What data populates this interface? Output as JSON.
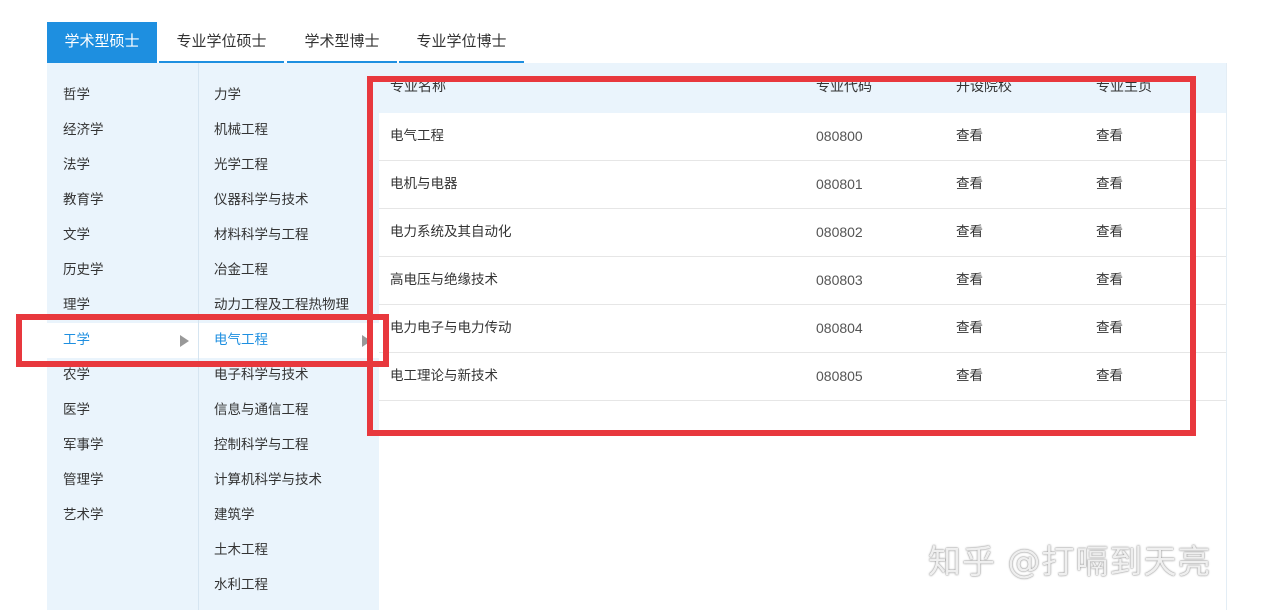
{
  "tabs": [
    {
      "label": "学术型硕士",
      "active": true
    },
    {
      "label": "专业学位硕士",
      "active": false
    },
    {
      "label": "学术型博士",
      "active": false
    },
    {
      "label": "专业学位博士",
      "active": false
    }
  ],
  "categories": [
    "哲学",
    "经济学",
    "法学",
    "教育学",
    "文学",
    "历史学",
    "理学",
    "工学",
    "农学",
    "医学",
    "军事学",
    "管理学",
    "艺术学"
  ],
  "selected_category": "工学",
  "disciplines": [
    "力学",
    "机械工程",
    "光学工程",
    "仪器科学与技术",
    "材料科学与工程",
    "冶金工程",
    "动力工程及工程热物理",
    "电气工程",
    "电子科学与技术",
    "信息与通信工程",
    "控制科学与工程",
    "计算机科学与技术",
    "建筑学",
    "土木工程",
    "水利工程"
  ],
  "selected_discipline": "电气工程",
  "table": {
    "headers": [
      "专业名称",
      "专业代码",
      "开设院校",
      "专业主页"
    ],
    "rows": [
      {
        "name": "电气工程",
        "code": "080800",
        "schools": "查看",
        "home": "查看"
      },
      {
        "name": "电机与电器",
        "code": "080801",
        "schools": "查看",
        "home": "查看"
      },
      {
        "name": "电力系统及其自动化",
        "code": "080802",
        "schools": "查看",
        "home": "查看"
      },
      {
        "name": "高电压与绝缘技术",
        "code": "080803",
        "schools": "查看",
        "home": "查看"
      },
      {
        "name": "电力电子与电力传动",
        "code": "080804",
        "schools": "查看",
        "home": "查看"
      },
      {
        "name": "电工理论与新技术",
        "code": "080805",
        "schools": "查看",
        "home": "查看"
      }
    ]
  },
  "watermark": "知乎 @打嗝到天亮",
  "colors": {
    "accent": "#1e8fe0",
    "sidebar_bg": "#eaf4fc",
    "highlight": "#e8383d"
  },
  "icons": {
    "submenu": "right-triangle-icon"
  }
}
